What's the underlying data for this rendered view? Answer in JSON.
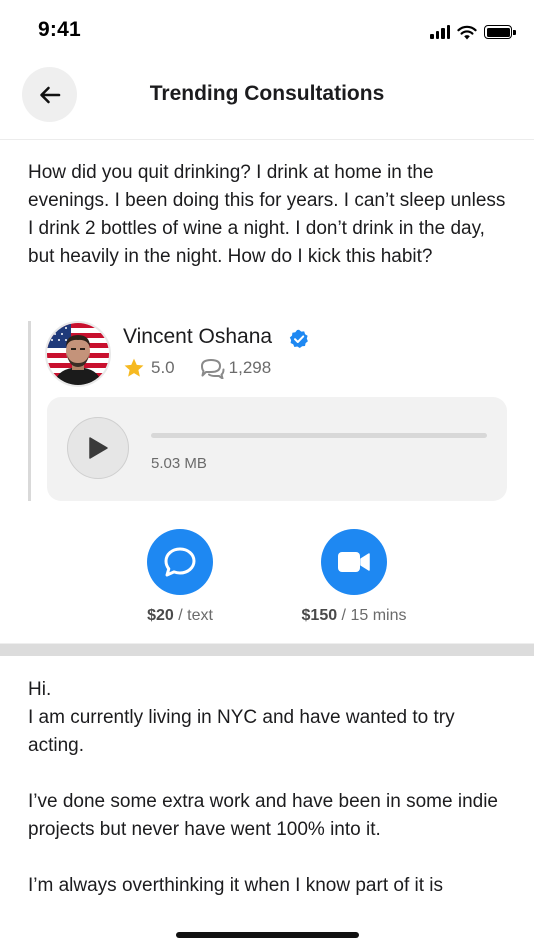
{
  "status_bar": {
    "time": "9:41"
  },
  "header": {
    "title": "Trending Consultations"
  },
  "question": {
    "text": "How did you quit drinking? I drink at home in the evenings. I been doing this for years. I can’t sleep unless I drink 2 bottles of wine a night. I don’t drink in the day, but heavily in the night. How do I kick this habit?"
  },
  "expert": {
    "name": "Vincent Oshana",
    "rating": "5.0",
    "reviews": "1,298"
  },
  "audio": {
    "file_size": "5.03 MB"
  },
  "actions": {
    "text": {
      "price": "$20",
      "unit": " / text"
    },
    "video": {
      "price": "$150",
      "unit": " / 15 mins"
    }
  },
  "second_post": {
    "text": "Hi.\nI am currently living in NYC and have wanted to try acting.\n\nI’ve done some extra work and have been in some indie projects but never have went 100% into it.\n\nI’m always overthinking it when I know part of it is"
  },
  "colors": {
    "accent": "#1e88f2",
    "star": "#f6b921",
    "verified": "#1e88f2"
  }
}
